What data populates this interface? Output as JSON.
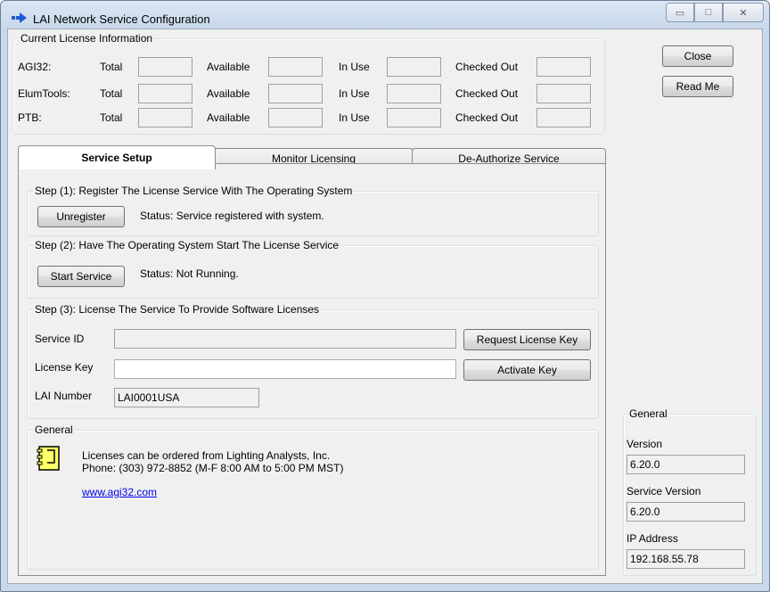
{
  "window": {
    "title": "LAI Network Service Configuration",
    "buttons": {
      "minimize": "▭",
      "maximize": "□",
      "close": "✕"
    }
  },
  "license_info": {
    "group_title": "Current License Information",
    "columns": [
      "Total",
      "Available",
      "In Use",
      "Checked Out"
    ],
    "rows": [
      {
        "name": "AGI32:",
        "total": "",
        "available": "",
        "in_use": "",
        "checked_out": ""
      },
      {
        "name": "ElumTools:",
        "total": "",
        "available": "",
        "in_use": "",
        "checked_out": ""
      },
      {
        "name": "PTB:",
        "total": "",
        "available": "",
        "in_use": "",
        "checked_out": ""
      }
    ]
  },
  "side_buttons": {
    "close": "Close",
    "read_me": "Read Me"
  },
  "tabs": [
    "Service Setup",
    "Monitor Licensing",
    "De-Authorize Service"
  ],
  "step1": {
    "title": "Step (1): Register The License Service With The Operating System",
    "button": "Unregister",
    "status": "Status: Service registered with system."
  },
  "step2": {
    "title": "Step (2): Have The Operating System Start The License Service",
    "button": "Start Service",
    "status": "Status: Not Running."
  },
  "step3": {
    "title": "Step (3): License The Service To Provide Software Licenses",
    "service_id_label": "Service ID",
    "service_id_value": "",
    "license_key_label": "License Key",
    "license_key_value": "",
    "lai_number_label": "LAI Number",
    "lai_number_value": "LAI0001USA",
    "request_button": "Request License Key",
    "activate_button": "Activate Key"
  },
  "general_info": {
    "title": "General",
    "line1": "Licenses can be ordered from Lighting Analysts, Inc.",
    "line2": "Phone: (303) 972-8852 (M-F 8:00 AM to 5:00 PM  MST)",
    "link": "www.agi32.com"
  },
  "general_side": {
    "title": "General",
    "version_label": "Version",
    "version_value": "6.20.0",
    "service_version_label": "Service Version",
    "service_version_value": "6.20.0",
    "ip_label": "IP Address",
    "ip_value": "192.168.55.78"
  }
}
